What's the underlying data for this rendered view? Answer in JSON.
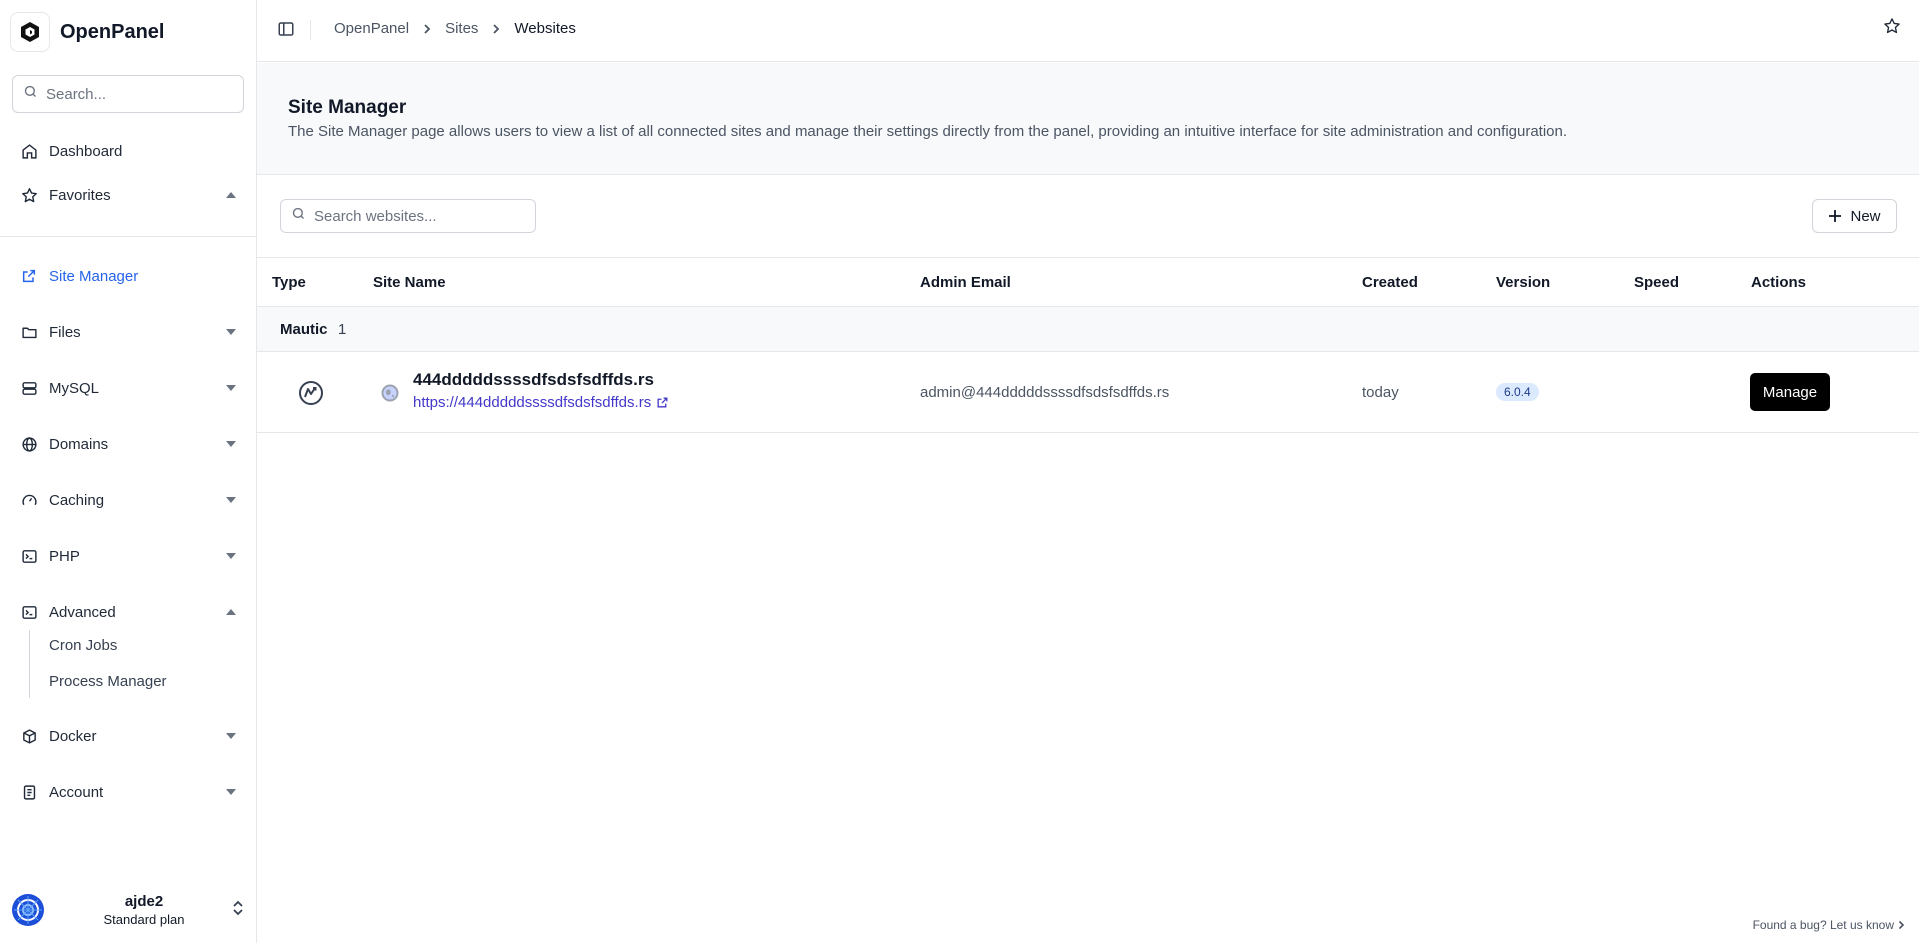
{
  "app": {
    "name": "OpenPanel"
  },
  "sidebar": {
    "search_placeholder": "Search...",
    "items": [
      {
        "label": "Dashboard",
        "icon": "home-icon"
      },
      {
        "label": "Favorites",
        "icon": "star-icon",
        "state": "expanded"
      },
      {
        "label": "Site Manager",
        "icon": "external-link-icon",
        "active": true
      },
      {
        "label": "Files",
        "icon": "folder-icon",
        "state": "collapsed"
      },
      {
        "label": "MySQL",
        "icon": "database-icon",
        "state": "collapsed"
      },
      {
        "label": "Domains",
        "icon": "globe-icon",
        "state": "collapsed"
      },
      {
        "label": "Caching",
        "icon": "gauge-icon",
        "state": "collapsed"
      },
      {
        "label": "PHP",
        "icon": "terminal-icon",
        "state": "collapsed"
      },
      {
        "label": "Advanced",
        "icon": "terminal-icon",
        "state": "expanded"
      },
      {
        "label": "Docker",
        "icon": "docker-icon",
        "state": "collapsed"
      },
      {
        "label": "Account",
        "icon": "document-icon",
        "state": "collapsed"
      }
    ],
    "advanced_children": [
      "Cron Jobs",
      "Process Manager"
    ],
    "user": {
      "name": "ajde2",
      "plan": "Standard plan"
    }
  },
  "topbar": {
    "breadcrumbs": [
      "OpenPanel",
      "Sites",
      "Websites"
    ]
  },
  "header": {
    "title": "Site Manager",
    "description": "The Site Manager page allows users to view a list of all connected sites and manage their settings directly from the panel, providing an intuitive interface for site administration and configuration."
  },
  "toolbar": {
    "search_placeholder": "Search websites...",
    "new_label": "New"
  },
  "table": {
    "columns": [
      "Type",
      "Site Name",
      "Admin Email",
      "Created",
      "Version",
      "Speed",
      "Actions"
    ],
    "groups": [
      {
        "name": "Mautic",
        "count": "1",
        "rows": [
          {
            "site_name": "444dddddssssdfsdsfsdffds.rs",
            "url": "https://444dddddssssdfsdsfsdffds.rs",
            "admin_email": "admin@444dddddssssdfsdsfsdffds.rs",
            "created": "today",
            "version": "6.0.4",
            "speed": "",
            "action_label": "Manage"
          }
        ]
      }
    ]
  },
  "footer": {
    "bug_link": "Found a bug? Let us know"
  },
  "colors": {
    "accent": "#2563eb",
    "link": "#4338ca",
    "badge_bg": "#dbeafe",
    "primary_button": "#000000"
  }
}
